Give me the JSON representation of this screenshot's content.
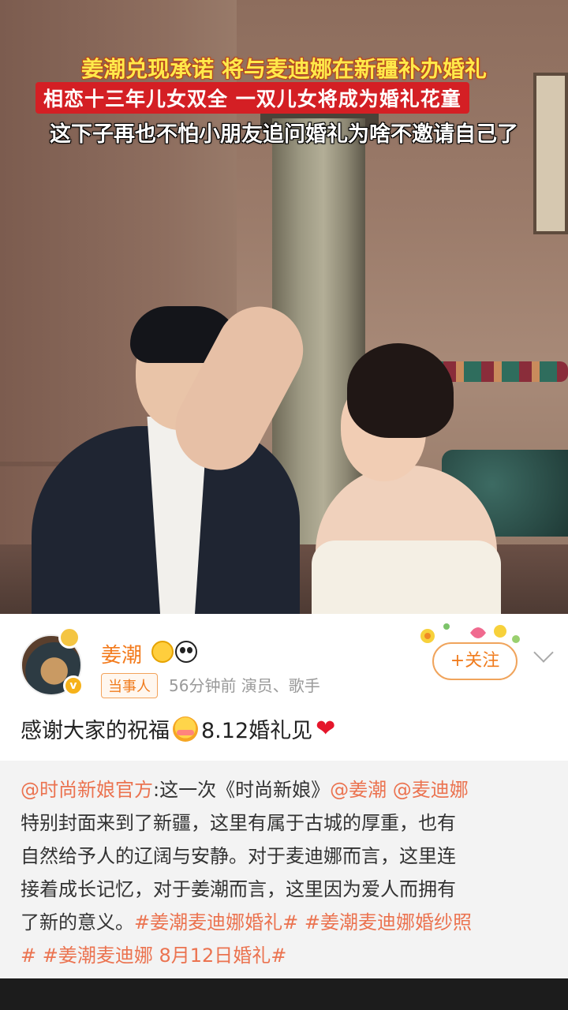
{
  "captions": {
    "line1": "姜潮兑现承诺 将与麦迪娜在新疆补办婚礼",
    "line2": "相恋十三年儿女双全 一双儿女将成为婚礼花童",
    "line3": "这下子再也不怕小朋友追问婚礼为啥不邀请自己了"
  },
  "post": {
    "username": "姜潮",
    "tag": "当事人",
    "meta": "56分钟前  演员、歌手",
    "follow_label": "+关注",
    "text_before": "感谢大家的祝福",
    "text_after": "8.12婚礼见",
    "emoji_icon": "blushing-face-icon",
    "heart_icon": "red-heart-icon"
  },
  "quote": {
    "mention_author": "@时尚新娘官方",
    "line1_rest": ":这一次《时尚新娘》",
    "mention_1": "@姜潮",
    "mention_2": "@麦迪娜",
    "line2": "特别封面来到了新疆，这里有属于古城的厚重，也有",
    "line3": "自然给予人的辽阔与安静。对于麦迪娜而言，这里连",
    "line4": "接着成长记忆，对于姜潮而言，这里因为爱人而拥有",
    "line5_prefix": "了新的意义。",
    "hashtag_1": "#姜潮麦迪娜婚礼#",
    "hashtag_2": "#姜潮麦迪娜婚纱照",
    "line6_prefix": "#",
    "hashtag_3": "#姜潮麦迪娜 8月12日婚礼#"
  },
  "colors": {
    "accent_orange": "#f07c1e",
    "link": "#eb7350",
    "caption_yellow": "#ffe94a",
    "caption_red_bg": "#d41f24"
  }
}
